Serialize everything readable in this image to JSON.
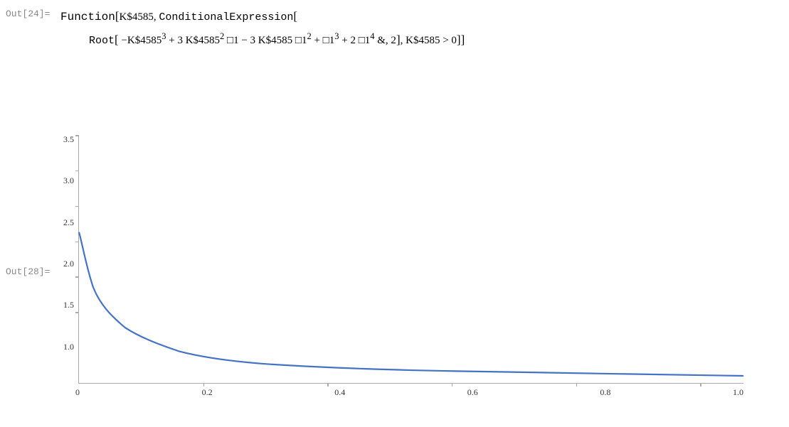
{
  "out24_label": "Out[24]=",
  "out28_label": "Out[28]=",
  "expression_line1": "Function",
  "expression_bracket1": "[",
  "expression_var": "K$4585",
  "expression_comma": ",",
  "expression_conditional": "ConditionalExpression",
  "expression_bracket2": "[",
  "expression_root": "Root",
  "expression_bracket3": "[",
  "expression_poly": "-K$4585³ + 3 K$4585² □1 - 3 K$4585 □1² + □1³ + 2 □1⁴",
  "expression_amp_two": "& , 2",
  "expression_bracket4": "]",
  "expression_cond": ", K$4585 > 0",
  "chart": {
    "y_labels": [
      "3.5",
      "3.0",
      "2.5",
      "2.0",
      "1.5",
      "1.0"
    ],
    "x_labels": [
      "0.2",
      "0.4",
      "0.6",
      "0.8",
      "1.0"
    ],
    "x_origin": "0",
    "color": "#4472C4"
  }
}
